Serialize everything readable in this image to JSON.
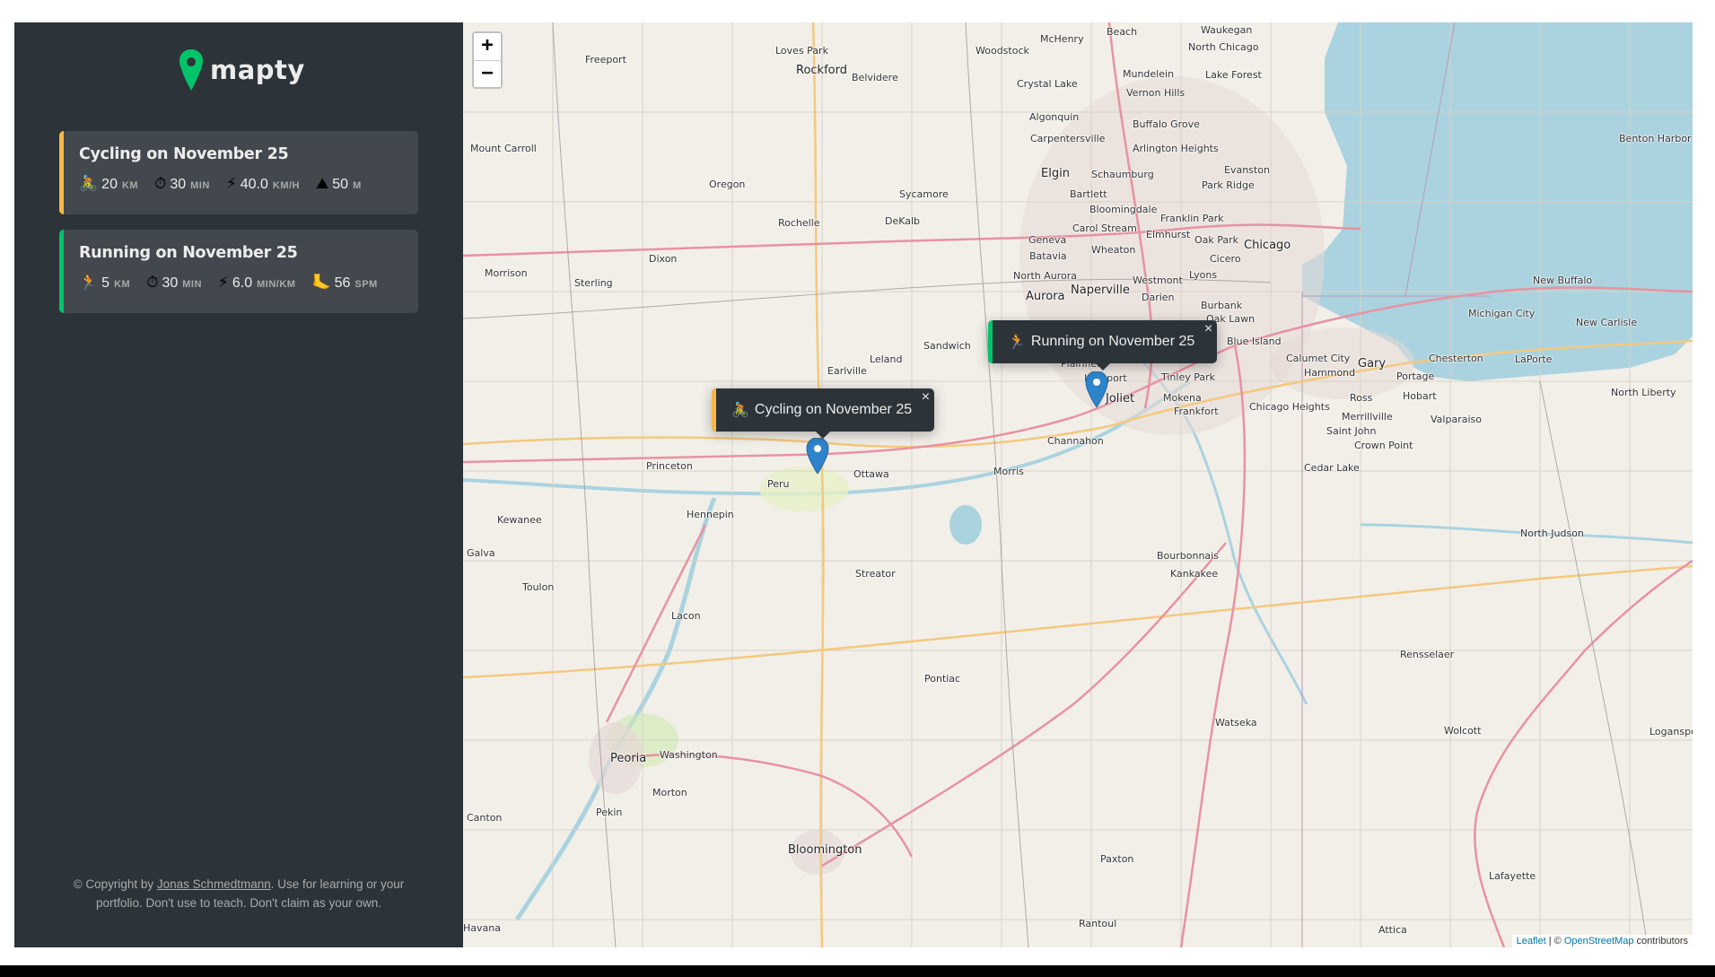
{
  "app": {
    "logo_text": "mapty",
    "logo_color": "#00c46a"
  },
  "workouts": [
    {
      "type": "cycling",
      "title": "Cycling on November 25",
      "accent": "#ffb545",
      "details": [
        {
          "icon": "bicycle-icon",
          "glyph": "🚴",
          "value": "20",
          "unit": "km"
        },
        {
          "icon": "stopwatch-icon",
          "glyph": "⏱",
          "value": "30",
          "unit": "min"
        },
        {
          "icon": "lightning-icon",
          "glyph": "⚡",
          "value": "40.0",
          "unit": "km/h"
        },
        {
          "icon": "mountain-icon",
          "glyph": "⛰",
          "value": "50",
          "unit": "m"
        }
      ]
    },
    {
      "type": "running",
      "title": "Running on November 25",
      "accent": "#00c46a",
      "details": [
        {
          "icon": "runner-icon",
          "glyph": "🏃",
          "value": "5",
          "unit": "km"
        },
        {
          "icon": "stopwatch-icon",
          "glyph": "⏱",
          "value": "30",
          "unit": "min"
        },
        {
          "icon": "lightning-icon",
          "glyph": "⚡",
          "value": "6.0",
          "unit": "min/km"
        },
        {
          "icon": "foot-icon",
          "glyph": "🦶",
          "value": "56",
          "unit": "spm"
        }
      ]
    }
  ],
  "copyright": {
    "prefix": "© Copyright by ",
    "author": "Jonas Schmedtmann",
    "suffix": ". Use for learning or your portfolio. Don't use to teach. Don't claim as your own."
  },
  "map": {
    "zoom_in": "+",
    "zoom_out": "−",
    "popups": [
      {
        "type": "cycling",
        "glyph": "🚴",
        "label": "Cycling on November 25",
        "close": "×"
      },
      {
        "type": "running",
        "glyph": "🏃",
        "label": "Running on November 25",
        "close": "×"
      }
    ],
    "attribution": {
      "leaflet": "Leaflet",
      "separator": " | © ",
      "osm": "OpenStreetMap",
      "suffix": " contributors"
    },
    "towns": [
      "Waukegan",
      "Beach",
      "McHenry",
      "North Chicago",
      "Lake Forest",
      "Mundelein",
      "Vernon Hills",
      "Buffalo Grove",
      "Loves Park",
      "Woodstock",
      "Freeport",
      "Rockford",
      "Belvidere",
      "Crystal Lake",
      "Algonquin",
      "Carpentersville",
      "Arlington Heights",
      "Mount Carroll",
      "Elgin",
      "Schaumburg",
      "Park Ridge",
      "Evanston",
      "Bartlett",
      "Bloomingdale",
      "Franklin Park",
      "Oregon",
      "Sycamore",
      "Carol Stream",
      "Elmhurst",
      "Oak Park",
      "Rochelle",
      "DeKalb",
      "Geneva",
      "Wheaton",
      "Cicero",
      "Chicago",
      "Batavia",
      "Lyons",
      "Dixon",
      "North Aurora",
      "Naperville",
      "Westmont",
      "Morrison",
      "Sterling",
      "Aurora",
      "Darien",
      "Burbank",
      "Oak Lawn",
      "New Buffalo",
      "Benton Harbor",
      "Michigan City",
      "New Carlisle",
      "Sandwich",
      "Blue Island",
      "Leland",
      "Calumet City",
      "Gary",
      "Chesterton",
      "Earlville",
      "Plainfield",
      "Hammond",
      "Portage",
      "LaPorte",
      "Lockport",
      "Tinley Park",
      "Ross",
      "Hobart",
      "North Liberty",
      "Joliet",
      "Mokena",
      "Frankfort",
      "Chicago Heights",
      "Merrillville",
      "Valparaiso",
      "Channahon",
      "Saint John",
      "Crown Point",
      "Princeton",
      "Morris",
      "Peru",
      "Ottawa",
      "Cedar Lake",
      "Hennepin",
      "Kewanee",
      "North Judson",
      "Galva",
      "Bourbonnais",
      "Kankakee",
      "Toulon",
      "Streator",
      "Lacon",
      "Rensselaer",
      "Pontiac",
      "Watseka",
      "Wolcott",
      "Logansport",
      "Peoria",
      "Washington",
      "Morton",
      "Canton",
      "Pekin",
      "Bloomington",
      "Paxton",
      "Lafayette",
      "Rantoul",
      "Attica",
      "Havana"
    ]
  }
}
